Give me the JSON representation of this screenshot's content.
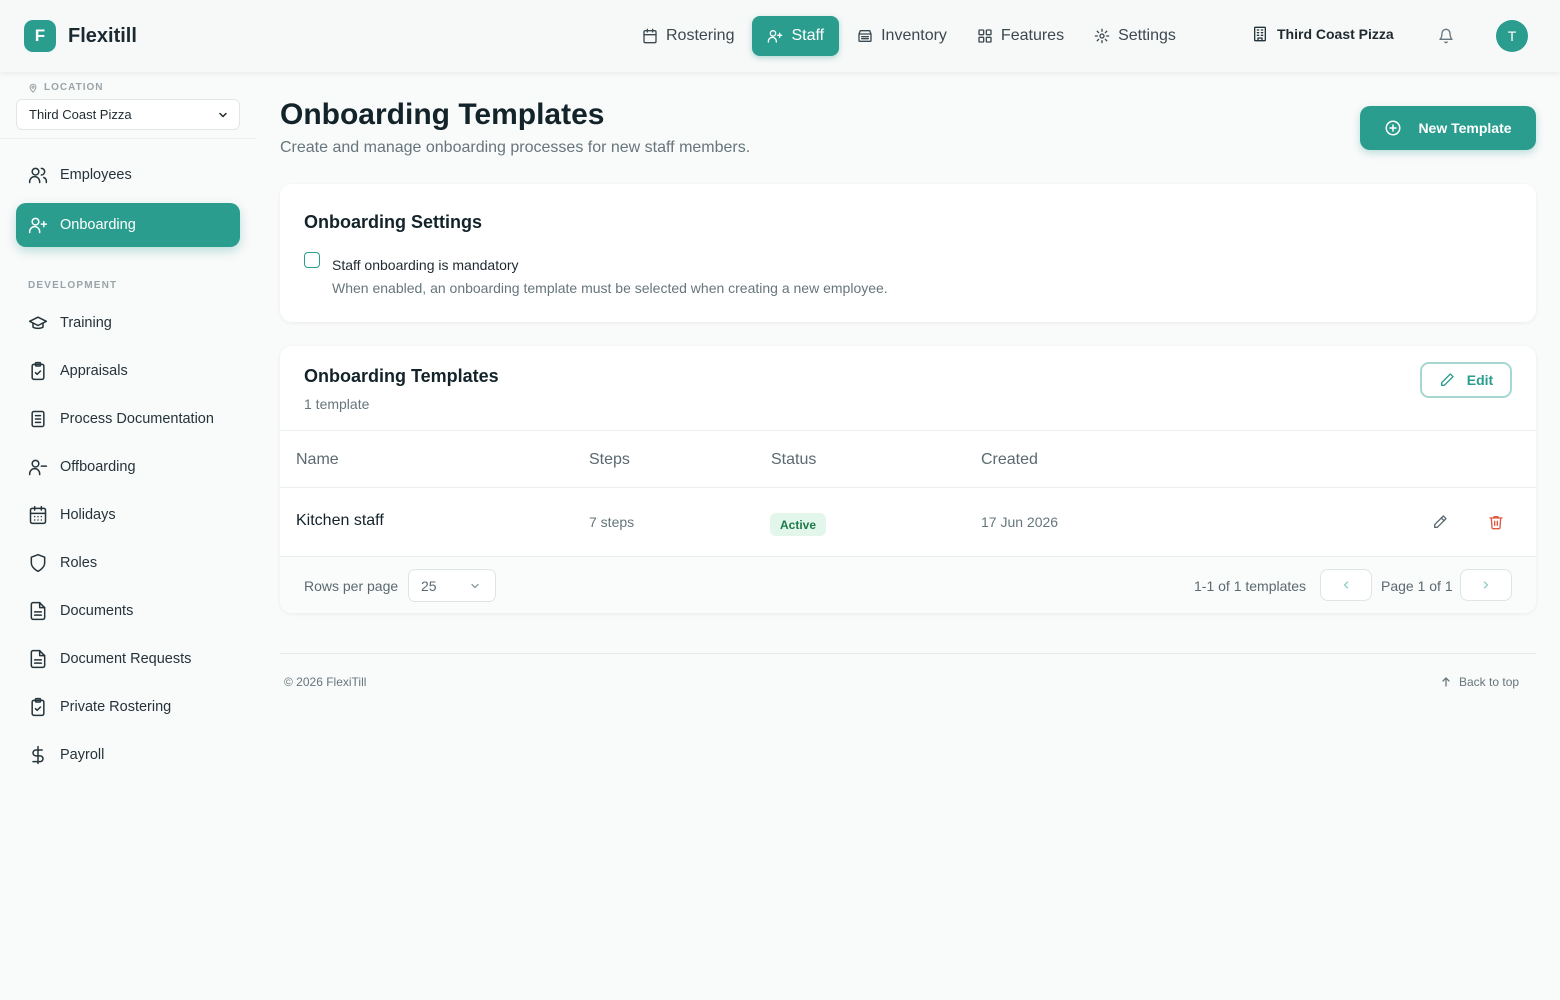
{
  "header": {
    "logo_letter": "F",
    "brand": "Flexitill",
    "nav": [
      {
        "label": "Rostering",
        "icon": "calendar-icon"
      },
      {
        "label": "Staff",
        "icon": "users-icon",
        "active": true
      },
      {
        "label": "Inventory",
        "icon": "archive-icon"
      },
      {
        "label": "Features",
        "icon": "grid-icon"
      },
      {
        "label": "Settings",
        "icon": "gear-icon"
      }
    ],
    "location_switcher": "Third Coast Pizza",
    "avatar_initial": "T"
  },
  "sidebar": {
    "location_label": "LOCATION",
    "location_value": "Third Coast Pizza",
    "items_top": [
      {
        "label": "Employees",
        "icon": "users-icon"
      },
      {
        "label": "Onboarding",
        "icon": "user-plus-icon",
        "active": true
      }
    ],
    "section_label": "DEVELOPMENT",
    "items_dev": [
      {
        "label": "Training",
        "icon": "graduation-cap-icon"
      },
      {
        "label": "Appraisals",
        "icon": "clipboard-check-icon"
      },
      {
        "label": "Process Documentation",
        "icon": "document-lines-icon"
      },
      {
        "label": "Offboarding",
        "icon": "user-minus-icon"
      },
      {
        "label": "Holidays",
        "icon": "calendar-days-icon"
      },
      {
        "label": "Roles",
        "icon": "shield-icon"
      },
      {
        "label": "Documents",
        "icon": "file-text-icon"
      },
      {
        "label": "Document Requests",
        "icon": "file-text-icon"
      },
      {
        "label": "Private Rostering",
        "icon": "clipboard-check-icon"
      },
      {
        "label": "Payroll",
        "icon": "dollar-icon"
      }
    ]
  },
  "main": {
    "title": "Onboarding Templates",
    "subtitle": "Create and manage onboarding processes for new staff members.",
    "new_button": "New Template",
    "settings": {
      "title": "Onboarding Settings",
      "checkbox_label": "Staff onboarding is mandatory",
      "checkbox_desc": "When enabled, an onboarding template must be selected when creating a new employee.",
      "checked": false
    },
    "templates": {
      "title": "Onboarding Templates",
      "count": "1 template",
      "edit_button": "Edit",
      "columns": [
        "Name",
        "Steps",
        "Status",
        "Created"
      ],
      "rows": [
        {
          "name": "Kitchen staff",
          "steps": "7 steps",
          "status": "Active",
          "created": "17 Jun 2026"
        }
      ],
      "rows_per_page_label": "Rows per page",
      "rows_per_page": "25",
      "range": "1-1 of 1 templates",
      "page": "Page 1 of 1"
    }
  },
  "footer": {
    "copyright": "© 2026 FlexiTill",
    "back_to_top": "Back to top"
  },
  "colors": {
    "accent": "#2a9d8f",
    "danger": "#e0563f",
    "badge_bg": "#e3f6ec",
    "badge_text": "#1e7a4a"
  }
}
